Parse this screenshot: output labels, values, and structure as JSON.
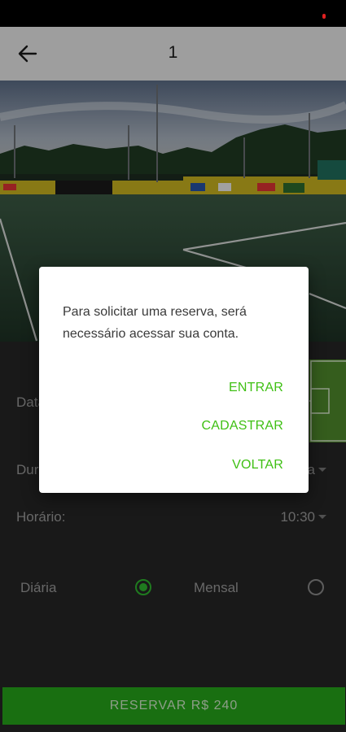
{
  "app_bar": {
    "title": "1"
  },
  "form": {
    "date_label": "Data:",
    "duration_label": "Duração:",
    "duration_value": "1 hora",
    "time_label": "Horário:",
    "time_value": "10:30",
    "plan_daily_label": "Diária",
    "plan_monthly_label": "Mensal",
    "selected_plan": "Diária"
  },
  "reserve_button": {
    "label": "RESERVAR R$ 240"
  },
  "dialog": {
    "message": "Para solicitar uma reserva, será necessário acessar sua conta.",
    "actions": [
      "ENTRAR",
      "CADASTRAR",
      "VOLTAR"
    ]
  },
  "colors": {
    "accent": "#2fb52f",
    "reserve_button": "#26a41a",
    "app_bar": "#9e9e9e",
    "background": "#262626"
  },
  "icons": {
    "back": "arrow-left-icon",
    "dropdown": "triangle-down-icon"
  }
}
